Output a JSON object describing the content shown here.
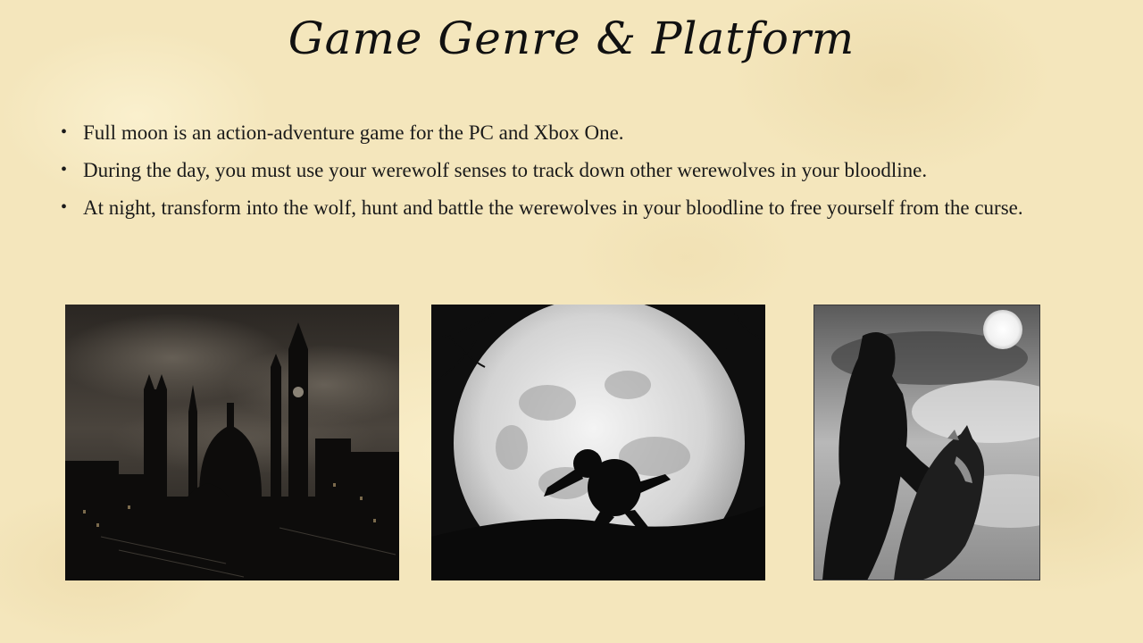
{
  "slide": {
    "title": "Game Genre & Platform",
    "bullets": [
      "Full moon is an action-adventure game for the PC and Xbox One.",
      "During the day, you must use your werewolf senses to track down other werewolves in your bloodline.",
      "At night, transform into the wolf, hunt and battle the werewolves in your bloodline to free yourself from the curse."
    ],
    "bullet_glyph": "•"
  },
  "images": [
    {
      "icon": "city-skyline-photo"
    },
    {
      "icon": "werewolf-full-moon-photo"
    },
    {
      "icon": "werewolf-statue-photo"
    }
  ],
  "colors": {
    "background": "#f4e6bc",
    "text": "#1a1a1a"
  }
}
